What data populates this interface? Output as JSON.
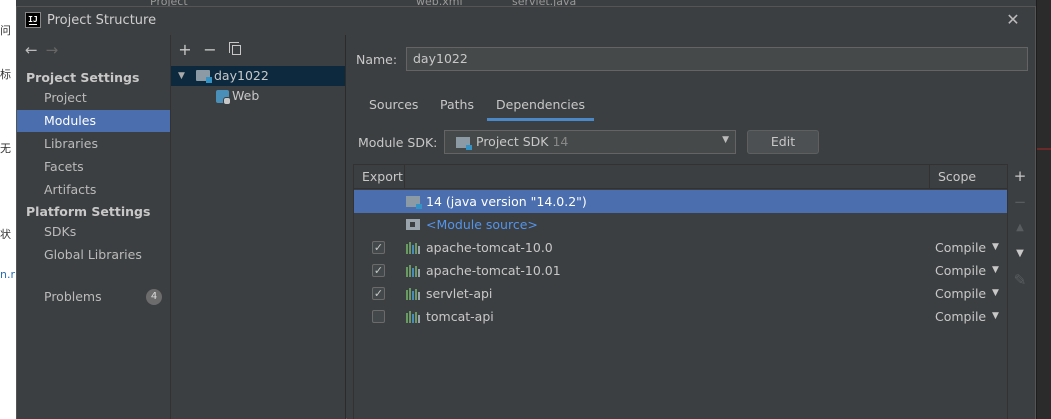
{
  "background": {
    "left_fragments": [
      "问",
      "标",
      "无",
      "状",
      "n.r"
    ],
    "top_fragments": [
      "Project",
      "web.xml",
      "servlet.java"
    ]
  },
  "dialog": {
    "title": "Project Structure",
    "close_glyph": "✕"
  },
  "nav": {
    "back_glyph": "←",
    "forward_glyph": "→",
    "project_settings_heading": "Project Settings",
    "project_settings_items": [
      "Project",
      "Modules",
      "Libraries",
      "Facets",
      "Artifacts"
    ],
    "platform_settings_heading": "Platform Settings",
    "platform_settings_items": [
      "SDKs",
      "Global Libraries"
    ],
    "problems_label": "Problems",
    "problems_count": "4",
    "selected": "Modules"
  },
  "tree": {
    "toolbar": {
      "add": "+",
      "remove": "−"
    },
    "module_name": "day1022",
    "facet_name": "Web"
  },
  "content": {
    "name_label": "Name:",
    "name_value": "day1022",
    "tabs": [
      "Sources",
      "Paths",
      "Dependencies"
    ],
    "active_tab": "Dependencies",
    "module_sdk_label": "Module SDK:",
    "module_sdk_value": "Project SDK",
    "module_sdk_version": "14",
    "edit_button": "Edit"
  },
  "dependencies": {
    "columns": {
      "export": "Export",
      "scope": "Scope"
    },
    "rows": [
      {
        "name": "14 (java version \"14.0.2\")",
        "checked": null,
        "scope": "",
        "selected": true
      },
      {
        "name": "<Module source>",
        "checked": null,
        "scope": "",
        "selected": false
      },
      {
        "name": "apache-tomcat-10.0",
        "checked": true,
        "scope": "Compile",
        "selected": false
      },
      {
        "name": "apache-tomcat-10.01",
        "checked": true,
        "scope": "Compile",
        "selected": false
      },
      {
        "name": "servlet-api",
        "checked": true,
        "scope": "Compile",
        "selected": false
      },
      {
        "name": "tomcat-api",
        "checked": false,
        "scope": "Compile",
        "selected": false
      }
    ],
    "checkmark": "✓",
    "dropdown_glyph": "▼",
    "side_toolbar": {
      "add": "+",
      "remove": "−",
      "up": "▲",
      "down": "▼",
      "edit": "✎"
    }
  },
  "colors": {
    "selection": "#4b6eaf",
    "tree_selection": "#0d293e",
    "link": "#5394ec",
    "tab_underline": "#4a88c7",
    "library_bars": "#6a9a63"
  }
}
